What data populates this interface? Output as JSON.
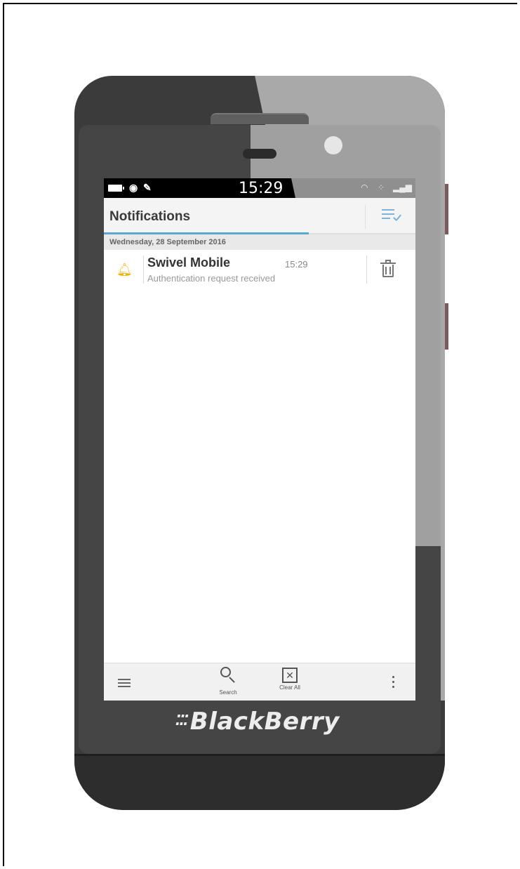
{
  "status_bar": {
    "time": "15:29"
  },
  "header": {
    "title": "Notifications"
  },
  "date_header": "Wednesday, 28 September 2016",
  "notifications": [
    {
      "title": "Swivel Mobile",
      "time": "15:29",
      "body": "Authentication request received",
      "icon": "bell-icon"
    }
  ],
  "action_bar": {
    "search_label": "Search",
    "clear_all_label": "Clear All"
  },
  "device": {
    "brand": "BlackBerry"
  },
  "colors": {
    "accent": "#5aa6d6",
    "bell": "#f2b200"
  }
}
